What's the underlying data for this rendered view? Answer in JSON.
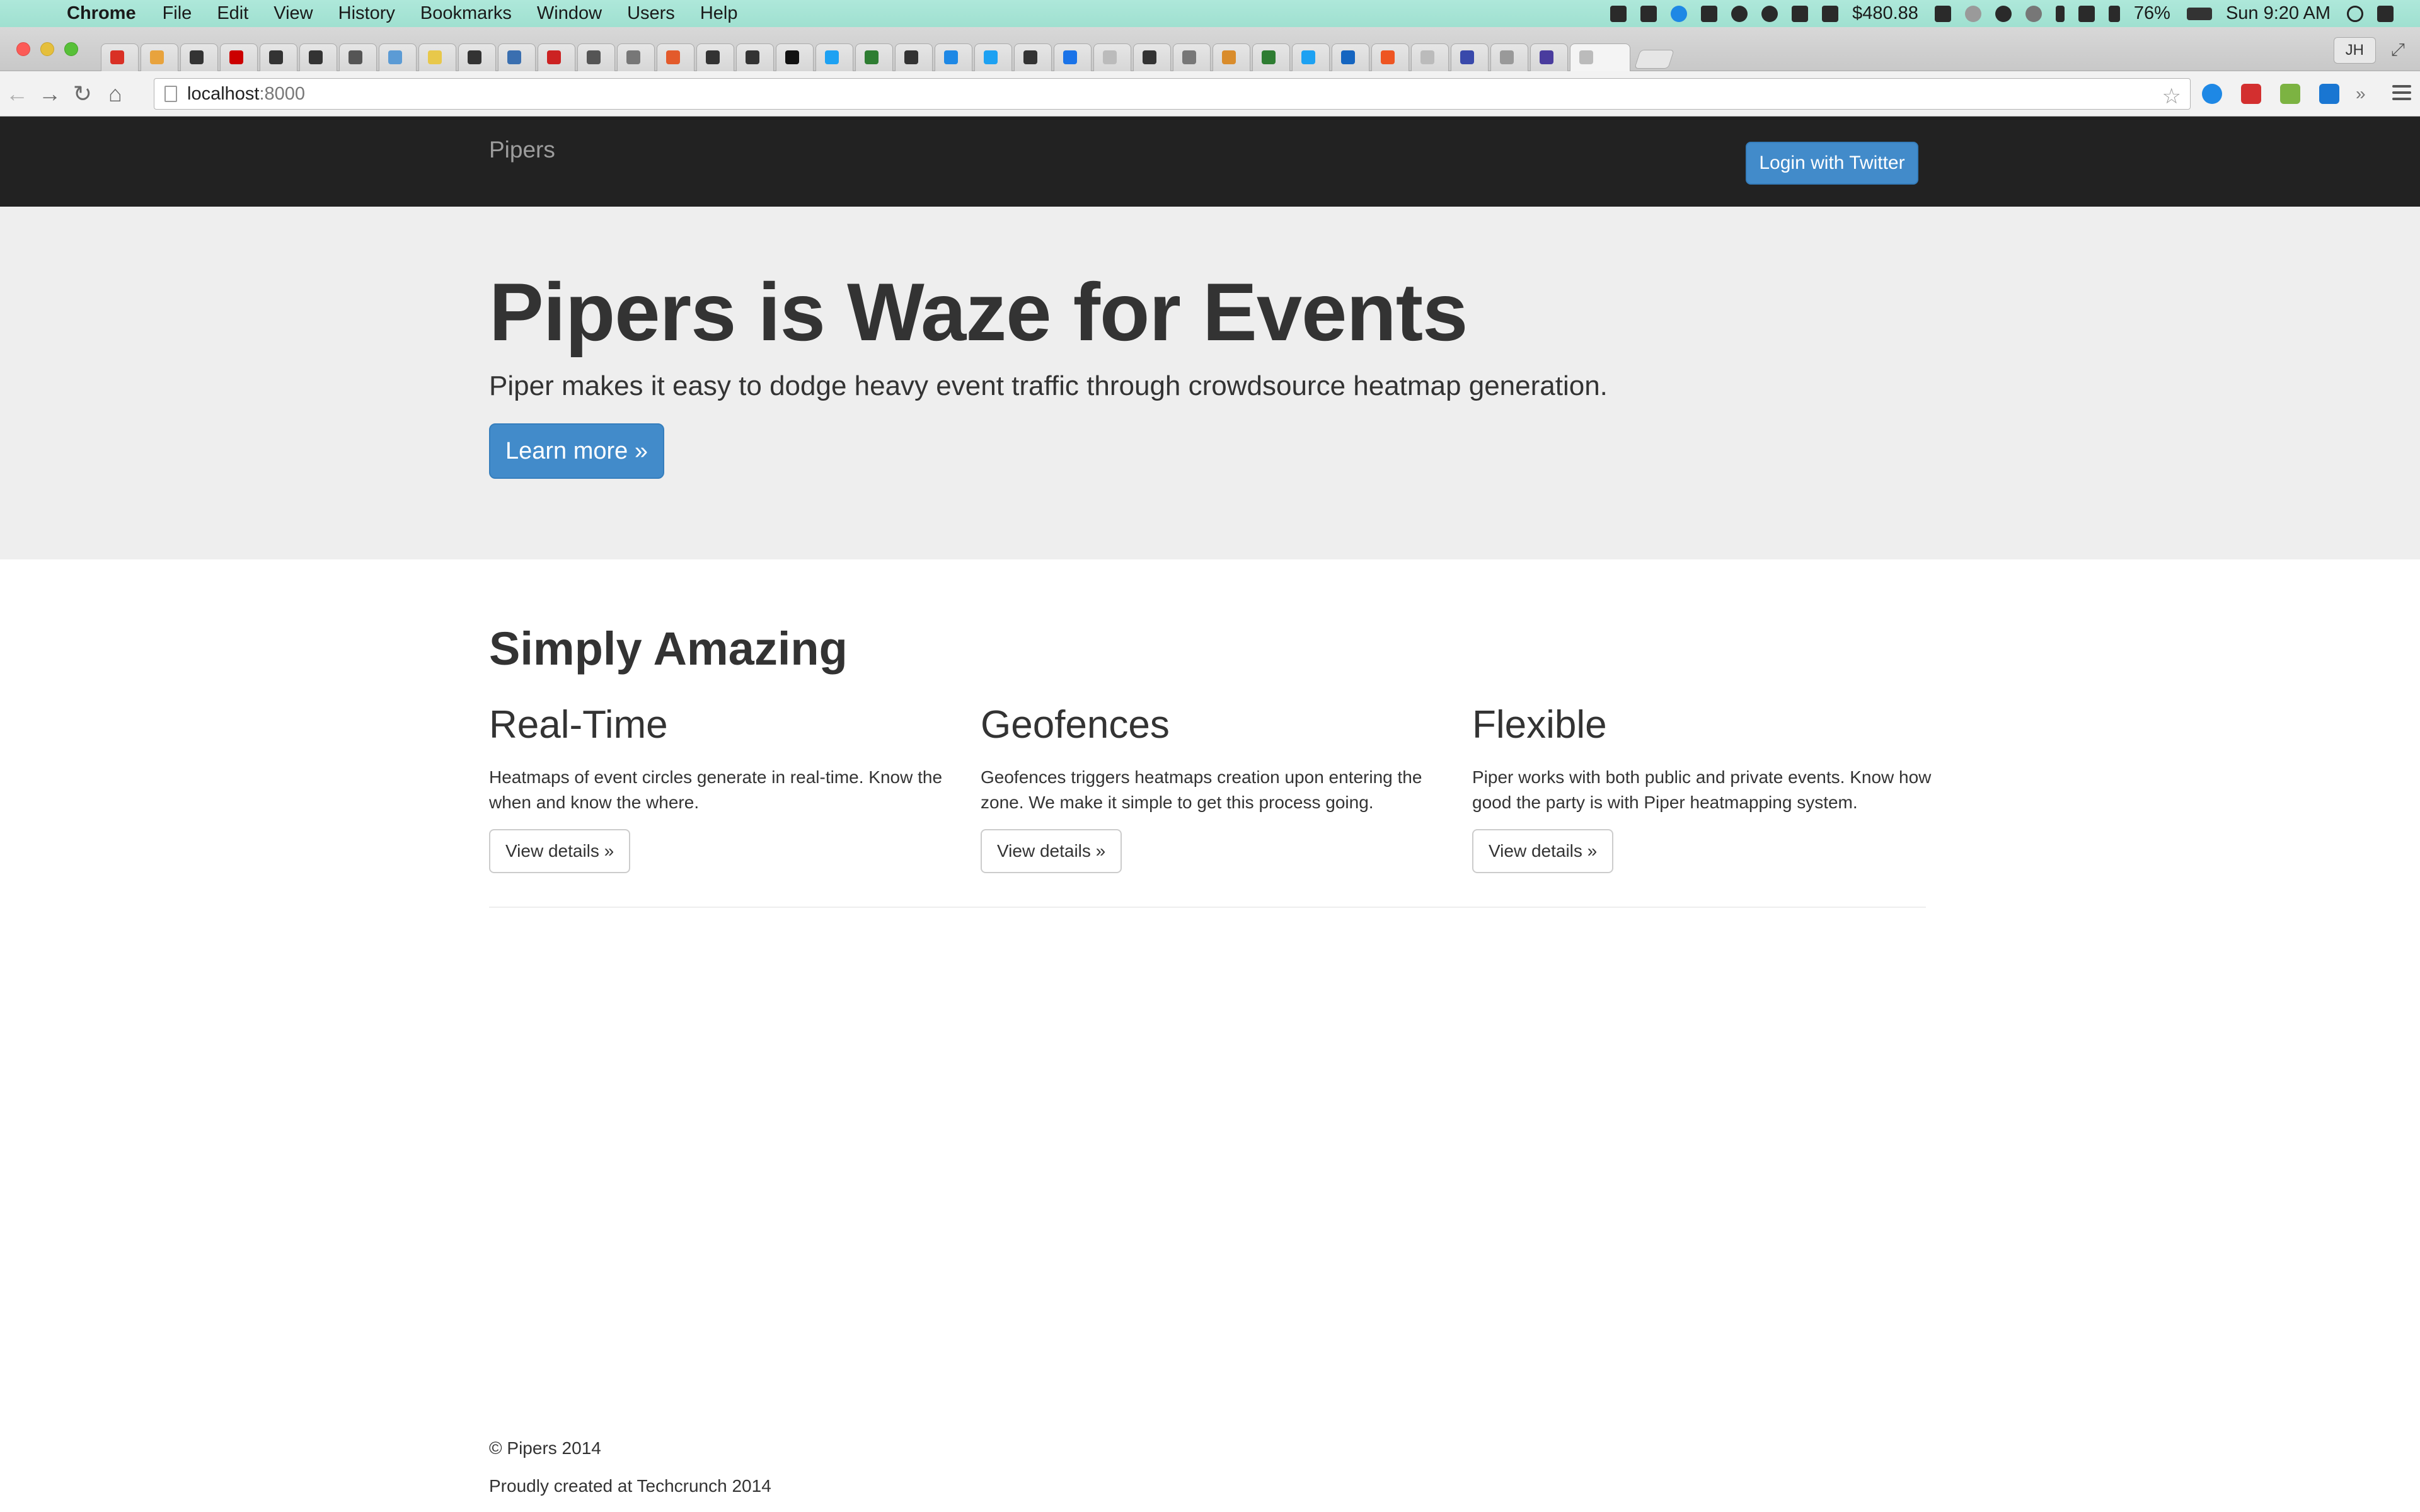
{
  "menubar": {
    "apple_glyph": "",
    "app_name": "Chrome",
    "items": [
      "File",
      "Edit",
      "View",
      "History",
      "Bookmarks",
      "Window",
      "Users",
      "Help"
    ],
    "price": "$480.88",
    "battery": "76%",
    "clock": "Sun 9:20 AM"
  },
  "browser": {
    "profile": "JH",
    "url_host": "localhost",
    "url_port": ":8000",
    "tab_colors": [
      "#d93025",
      "#e8a33d",
      "#333333",
      "#cc0000",
      "#333333",
      "#333333",
      "#555555",
      "#5b9bd5",
      "#e8c84a",
      "#333333",
      "#3a6fb0",
      "#cc2222",
      "#555555",
      "#777777",
      "#e35a2b",
      "#333333",
      "#333333",
      "#111111",
      "#1da1f2",
      "#2e7d32",
      "#333333",
      "#1e88e5",
      "#1da1f2",
      "#333333",
      "#1a73e8",
      "#bbbbbb",
      "#333333",
      "#777777",
      "#d98c2b",
      "#2e7d32",
      "#1da1f2",
      "#1565c0",
      "#ee5522",
      "#bbbbbb",
      "#3949ab",
      "#999999",
      "#4a3c9e",
      "#bbbbbb"
    ]
  },
  "site": {
    "brand": "Pipers",
    "login_label": "Login with Twitter",
    "hero_title": "Pipers is Waze for Events",
    "hero_lead": "Piper makes it easy to dodge heavy event traffic through crowdsource heatmap generation.",
    "learn_more": "Learn more »",
    "section_title": "Simply Amazing",
    "features": [
      {
        "title": "Real-Time",
        "text": "Heatmaps of event circles generate in real-time. Know the when and know the where.",
        "button": "View details »"
      },
      {
        "title": "Geofences",
        "text": "Geofences triggers heatmaps creation upon entering the zone. We make it simple to get this process going.",
        "button": "View details »"
      },
      {
        "title": "Flexible",
        "text": "Piper works with both public and private events. Know how good the party is with Piper heatmapping system.",
        "button": "View details »"
      }
    ],
    "footer_copyright": "© Pipers 2014",
    "footer_credit": "Proudly created at Techcrunch 2014"
  }
}
